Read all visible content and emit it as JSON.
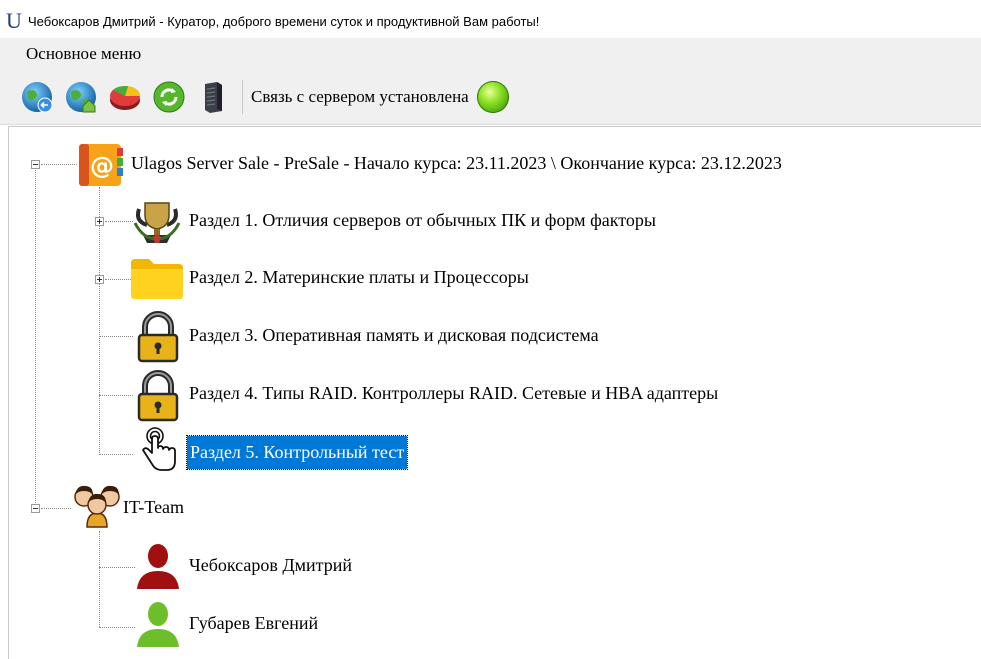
{
  "window": {
    "title": "Чебоксаров Дмитрий - Куратор, доброго времени суток и продуктивной Вам работы!",
    "app_icon_letter": "U"
  },
  "menu": {
    "main": "Основное меню"
  },
  "toolbar": {
    "buttons": [
      "globe-back-icon",
      "globe-home-icon",
      "pie-chart-icon",
      "refresh-icon",
      "server-icon"
    ],
    "status": "Связь с сервером установлена",
    "status_color": "#5cc41a"
  },
  "tree": {
    "course": {
      "label": "Ulagos Server Sale - PreSale - Начало курса: 23.11.2023 \\ Окончание курса: 23.12.2023",
      "icon": "address-book-icon",
      "sections": [
        {
          "label": "Раздел 1. Отличия серверов от обычных ПК и форм факторы",
          "icon": "trophy-icon",
          "state": "expandable"
        },
        {
          "label": "Раздел 2. Материнские платы и Процессоры",
          "icon": "folder-icon",
          "state": "expandable"
        },
        {
          "label": "Раздел 3. Оперативная память и дисковая подсистема",
          "icon": "lock-icon",
          "state": "locked"
        },
        {
          "label": "Раздел 4. Типы RAID. Контроллеры RAID. Сетевые и HBA адаптеры",
          "icon": "lock-icon",
          "state": "locked"
        },
        {
          "label": "Раздел 5. Контрольный тест",
          "icon": "hand-pointer-icon",
          "state": "selected"
        }
      ]
    },
    "team": {
      "label": "IT-Team",
      "icon": "group-icon",
      "members": [
        {
          "name": "Чебоксаров Дмитрий",
          "icon": "user-red-icon",
          "color": "#a01010"
        },
        {
          "name": "Губарев Евгений",
          "icon": "user-green-icon",
          "color": "#6cbf2a"
        }
      ]
    }
  }
}
